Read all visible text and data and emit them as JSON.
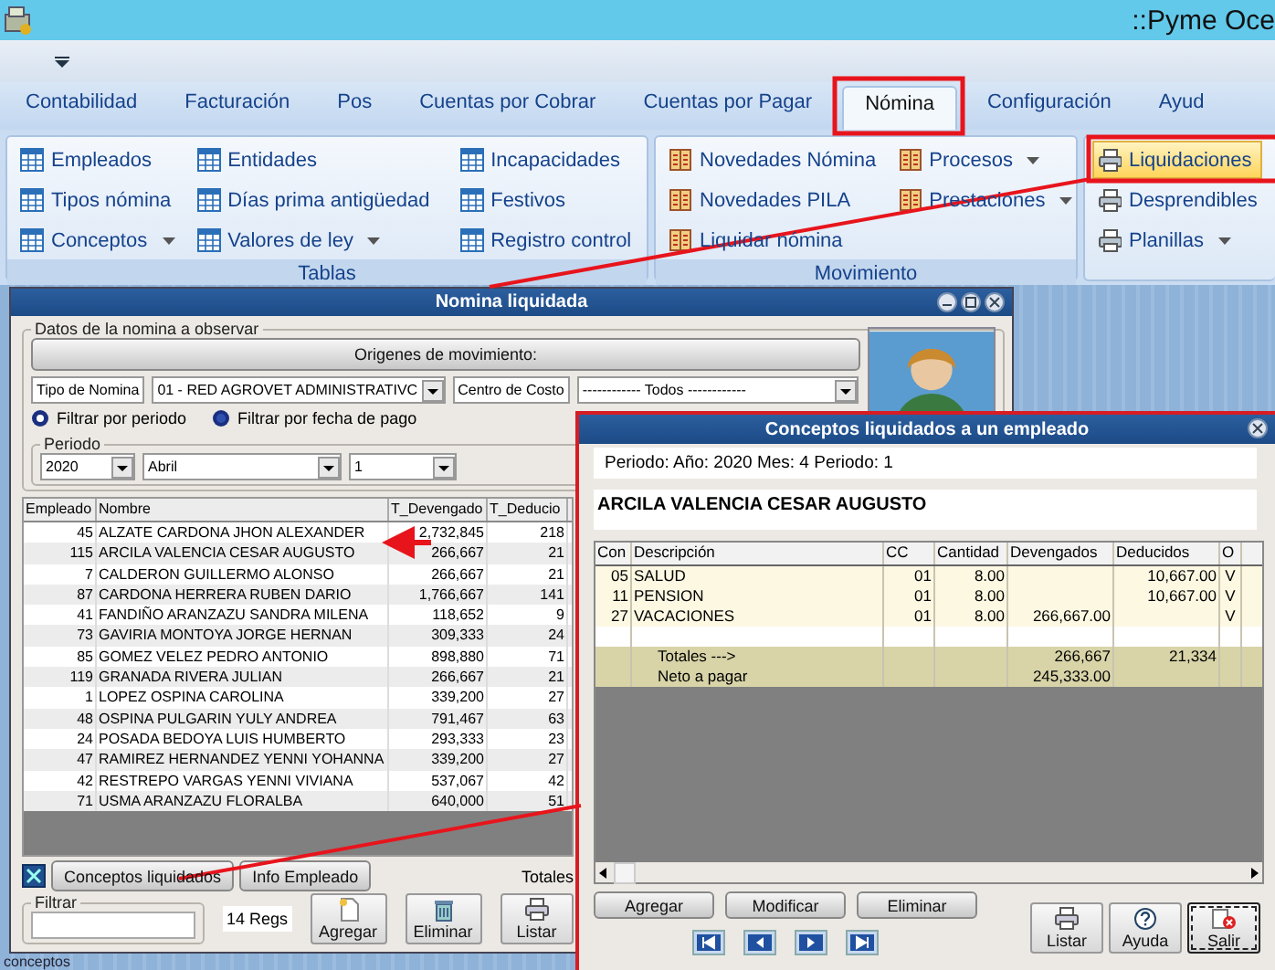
{
  "app_title": "::Pyme Oce",
  "ribbon_tabs": [
    {
      "label": "Contabilidad",
      "selected": false
    },
    {
      "label": "Facturación",
      "selected": false
    },
    {
      "label": "Pos",
      "selected": false
    },
    {
      "label": "Cuentas por Cobrar",
      "selected": false
    },
    {
      "label": "Cuentas por Pagar",
      "selected": false
    },
    {
      "label": "Nómina",
      "selected": true
    },
    {
      "label": "Configuración",
      "selected": false
    },
    {
      "label": "Ayud",
      "selected": false
    }
  ],
  "ribbon_groups": [
    {
      "title": "Tablas",
      "kind": "grid",
      "columns": [
        [
          {
            "label": "Empleados",
            "dropdown": false,
            "highlighted": false
          },
          {
            "label": "Tipos nómina",
            "dropdown": false,
            "highlighted": false
          },
          {
            "label": "Conceptos",
            "dropdown": true,
            "highlighted": false
          }
        ],
        [
          {
            "label": "Entidades",
            "dropdown": false,
            "highlighted": false
          },
          {
            "label": "Días prima antigüedad",
            "dropdown": false,
            "highlighted": false
          },
          {
            "label": "Valores de ley",
            "dropdown": true,
            "highlighted": false
          }
        ],
        [
          {
            "label": "Incapacidades",
            "dropdown": false,
            "highlighted": false
          },
          {
            "label": "Festivos",
            "dropdown": false,
            "highlighted": false
          },
          {
            "label": "Registro control",
            "dropdown": false,
            "highlighted": false
          }
        ]
      ]
    },
    {
      "title": "Movimiento",
      "kind": "book",
      "columns": [
        [
          {
            "label": "Novedades Nómina",
            "dropdown": false,
            "highlighted": false
          },
          {
            "label": "Novedades PILA",
            "dropdown": false,
            "highlighted": false
          },
          {
            "label": "Liquidar nómina",
            "dropdown": false,
            "highlighted": false
          }
        ],
        [
          {
            "label": "Procesos",
            "dropdown": true,
            "highlighted": false
          },
          {
            "label": "Prestaciones",
            "dropdown": true,
            "highlighted": false
          }
        ]
      ]
    },
    {
      "kind": "printer",
      "columns": [
        [
          {
            "label": "Liquidaciones",
            "dropdown": false,
            "highlighted": true
          },
          {
            "label": "Desprendibles",
            "dropdown": false,
            "highlighted": false
          },
          {
            "label": "Planillas",
            "dropdown": true,
            "highlighted": false
          }
        ]
      ]
    }
  ],
  "left_window": {
    "title": "Nomina liquidada",
    "data_group": "Datos de la nomina a observar",
    "origins_button": "Origenes de movimiento:",
    "payroll_type_label": "Tipo de Nomina",
    "payroll_type": "01 - RED AGROVET ADMINISTRATIVC",
    "cost_center_label": "Centro de Costo",
    "cost_center": "------------ Todos ------------",
    "filters": [
      {
        "label": "Filtrar por periodo",
        "selected": true
      },
      {
        "label": "Filtrar por fecha de pago",
        "selected": false
      }
    ],
    "period_label": "Periodo",
    "period": [
      "2020",
      "Abril",
      "1"
    ],
    "table": {
      "columns": [
        "Empleado",
        "Nombre",
        "T_Devengado",
        "T_Deducio"
      ],
      "rows": [
        [
          "45",
          "ALZATE CARDONA JHON ALEXANDER",
          "2,732,845",
          "218"
        ],
        [
          "115",
          "ARCILA VALENCIA CESAR AUGUSTO",
          "266,667",
          "21"
        ],
        [
          "7",
          "CALDERON  GUILLERMO ALONSO",
          "266,667",
          "21"
        ],
        [
          "87",
          "CARDONA HERRERA RUBEN DARIO",
          "1,766,667",
          "141"
        ],
        [
          "41",
          "FANDIÑO ARANZAZU SANDRA MILENA",
          "118,652",
          "9"
        ],
        [
          "73",
          "GAVIRIA MONTOYA JORGE HERNAN",
          "309,333",
          "24"
        ],
        [
          "85",
          "GOMEZ VELEZ PEDRO ANTONIO",
          "898,880",
          "71"
        ],
        [
          "119",
          "GRANADA RIVERA JULIAN",
          "266,667",
          "21"
        ],
        [
          "1",
          "LOPEZ OSPINA CAROLINA",
          "339,200",
          "27"
        ],
        [
          "48",
          "OSPINA PULGARIN YULY ANDREA",
          "791,467",
          "63"
        ],
        [
          "24",
          "POSADA BEDOYA LUIS HUMBERTO",
          "293,333",
          "23"
        ],
        [
          "47",
          "RAMIREZ HERNANDEZ YENNI YOHANNA",
          "339,200",
          "27"
        ],
        [
          "42",
          "RESTREPO VARGAS YENNI VIVIANA",
          "537,067",
          "42"
        ],
        [
          "71",
          "USMA ARANZAZU FLORALBA",
          "640,000",
          "51"
        ]
      ]
    },
    "buttons": [
      "Conceptos liquidados",
      "Info Empleado"
    ],
    "totals_label": "Totales",
    "filter_label": "Filtrar",
    "record_count": "14 Regs",
    "actions": [
      {
        "label": "Agregar",
        "kind": "add"
      },
      {
        "label": "Eliminar",
        "kind": "delete"
      },
      {
        "label": "Listar",
        "kind": "print"
      }
    ]
  },
  "right_window": {
    "title": "Conceptos liquidados a un empleado",
    "period_text": "Periodo: Año: 2020 Mes: 4 Periodo: 1",
    "employee_name": "ARCILA VALENCIA CESAR AUGUSTO",
    "table": {
      "columns": [
        "Con",
        "Descripción",
        "CC",
        "Cantidad",
        "Devengados",
        "Deducidos",
        "O"
      ],
      "rows": [
        {
          "kind": "item",
          "cells": [
            "05",
            "SALUD",
            "01",
            "8.00",
            null,
            "10,667.00",
            "V"
          ]
        },
        {
          "kind": "item",
          "cells": [
            "11",
            "PENSION",
            "01",
            "8.00",
            null,
            "10,667.00",
            "V"
          ]
        },
        {
          "kind": "item",
          "cells": [
            "27",
            "VACACIONES",
            "01",
            "8.00",
            "266,667.00",
            null,
            "V"
          ]
        },
        {
          "kind": "blank"
        },
        {
          "kind": "total",
          "cells": [
            null,
            "Totales --->",
            null,
            null,
            "266,667",
            "21,334",
            null
          ]
        },
        {
          "kind": "total",
          "cells": [
            null,
            "Neto a pagar",
            null,
            null,
            "245,333.00",
            null,
            null
          ]
        }
      ]
    },
    "buttons": [
      "Agregar",
      "Modificar",
      "Eliminar"
    ],
    "actions": [
      {
        "label": "Listar",
        "kind": "print",
        "focused": false
      },
      {
        "label": "Ayuda",
        "kind": "help",
        "focused": false
      },
      {
        "label": "Salir",
        "kind": "exit",
        "focused": true
      }
    ]
  },
  "background_text": "conceptos"
}
